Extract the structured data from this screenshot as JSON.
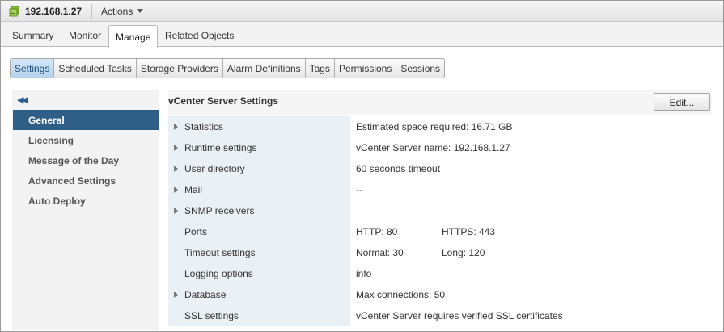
{
  "header": {
    "host": "192.168.1.27",
    "actions_label": "Actions"
  },
  "top_tabs": [
    "Summary",
    "Monitor",
    "Manage",
    "Related Objects"
  ],
  "active_top_tab": "Manage",
  "sub_tabs": [
    "Settings",
    "Scheduled Tasks",
    "Storage Providers",
    "Alarm Definitions",
    "Tags",
    "Permissions",
    "Sessions"
  ],
  "active_sub_tab": "Settings",
  "nav": {
    "collapse_glyph": "◀◀",
    "items": [
      "General",
      "Licensing",
      "Message of the Day",
      "Advanced Settings",
      "Auto Deploy"
    ],
    "active": "General"
  },
  "content": {
    "title": "vCenter Server Settings",
    "edit_label": "Edit...",
    "rows": [
      {
        "name": "Statistics",
        "value": "Estimated space required: 16.71 GB",
        "value2": "",
        "expandable": true
      },
      {
        "name": "Runtime settings",
        "value": "vCenter Server name: 192.168.1.27",
        "value2": "",
        "expandable": true
      },
      {
        "name": "User directory",
        "value": "60 seconds timeout",
        "value2": "",
        "expandable": true
      },
      {
        "name": "Mail",
        "value": "--",
        "value2": "",
        "expandable": true
      },
      {
        "name": "SNMP receivers",
        "value": "",
        "value2": "",
        "expandable": true
      },
      {
        "name": "Ports",
        "value": "HTTP: 80",
        "value2": "HTTPS: 443",
        "expandable": false
      },
      {
        "name": "Timeout settings",
        "value": "Normal: 30",
        "value2": "Long: 120",
        "expandable": false
      },
      {
        "name": "Logging options",
        "value": "info",
        "value2": "",
        "expandable": false
      },
      {
        "name": "Database",
        "value": "Max connections: 50",
        "value2": "",
        "expandable": true
      },
      {
        "name": "SSL settings",
        "value": "vCenter Server requires verified SSL certificates",
        "value2": "",
        "expandable": false
      }
    ]
  },
  "colors": {
    "nav_active": "#2f5e86",
    "subtab_active": "#b6d3ee",
    "name_cell_bg": "#e9f0f6"
  }
}
